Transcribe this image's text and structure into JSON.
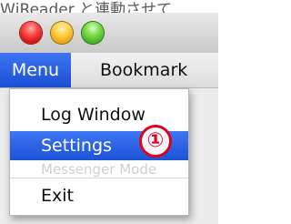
{
  "header": {
    "caption": "WjReader と連動させて"
  },
  "window": {
    "traffic_lights": {
      "close_color": "#e01f1f",
      "minimize_color": "#f2b21b",
      "zoom_color": "#4bbf2f"
    }
  },
  "menubar": {
    "items": [
      {
        "label": "Menu",
        "active": true
      },
      {
        "label": "Bookmark",
        "active": false
      }
    ]
  },
  "dropdown": {
    "items": [
      {
        "label": "Log Window",
        "highlighted": false
      },
      {
        "label": "Settings",
        "highlighted": true
      },
      {
        "label": "Messenger Mode",
        "disabled": true
      },
      {
        "label": "Exit",
        "highlighted": false
      }
    ]
  },
  "annotation": {
    "marker": "①",
    "color": "#e3001b"
  },
  "theme": {
    "selection_blue": "#2b62e6"
  }
}
